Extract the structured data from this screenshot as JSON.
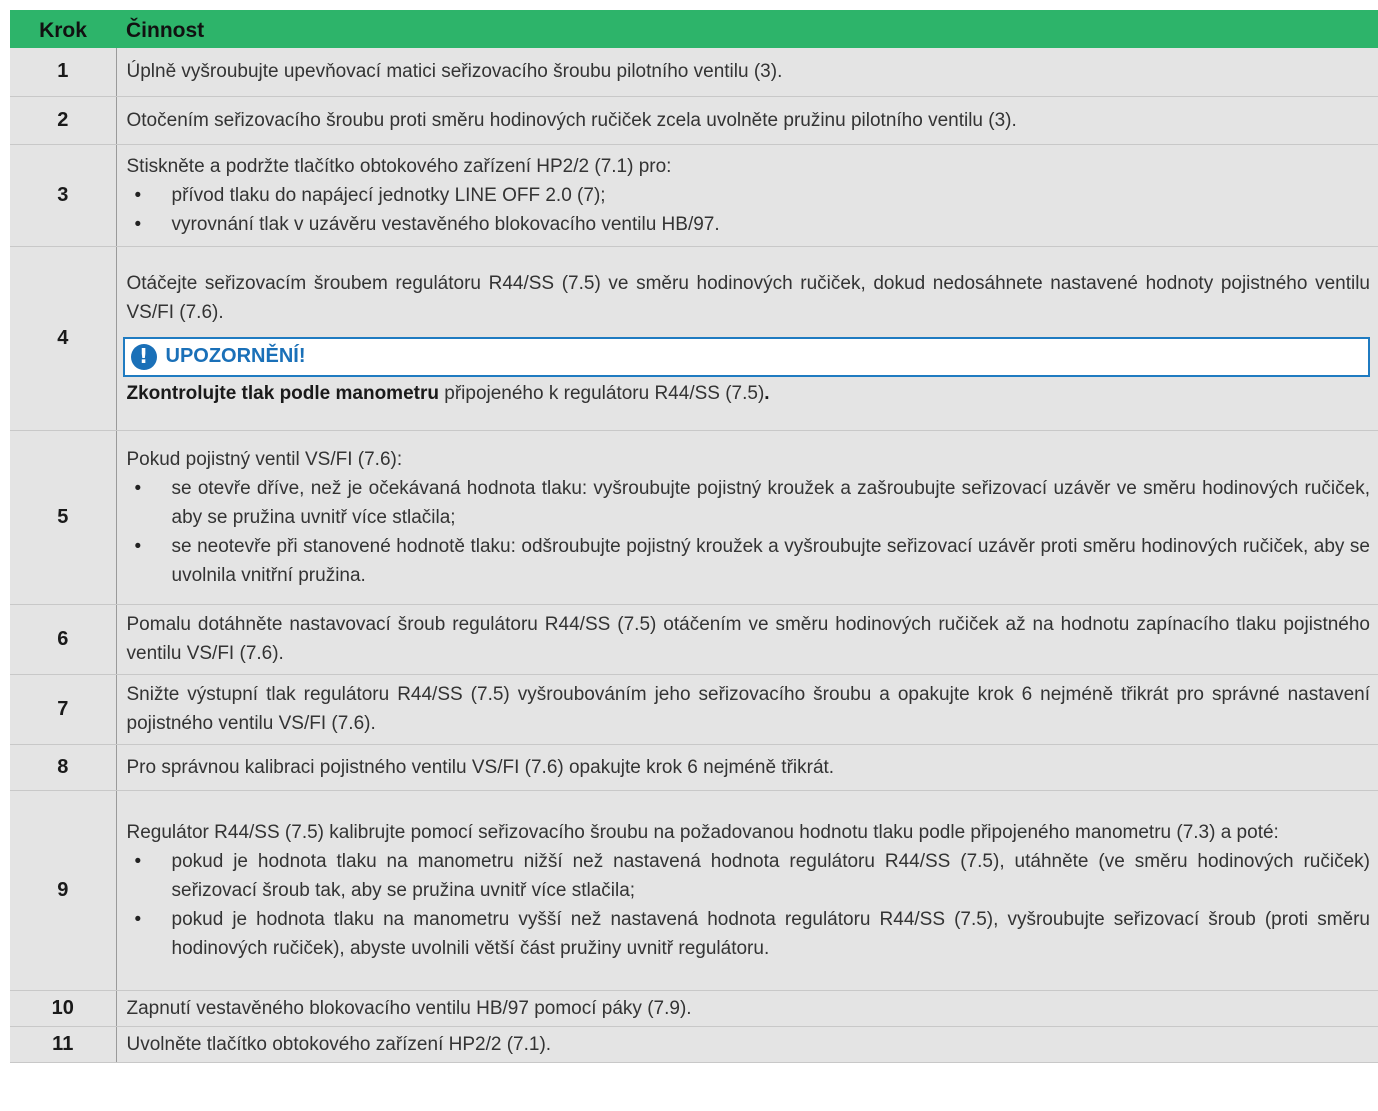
{
  "header": {
    "step": "Krok",
    "activity": "Činnost"
  },
  "rows": [
    {
      "step": "1",
      "text": "Úplně vyšroubujte upevňovací matici seřizovacího šroubu pilotního ventilu (3)."
    },
    {
      "step": "2",
      "text": "Otočením seřizovacího šroubu proti směru hodinových ručiček zcela uvolněte pružinu pilotního ventilu (3)."
    },
    {
      "step": "3",
      "text": "Stiskněte a podržte tlačítko obtokového zařízení HP2/2 (7.1) pro:",
      "bullets": [
        "přívod tlaku do napájecí jednotky LINE OFF 2.0 (7);",
        "vyrovnání tlak v uzávěru vestavěného blokovacího ventilu HB/97."
      ]
    },
    {
      "step": "4",
      "text": "Otáčejte seřizovacím šroubem regulátoru R44/SS (7.5) ve směru hodinových ručiček, dokud nedosáhnete nastavené hodnoty pojistného ventilu VS/FI (7.6).",
      "warning": {
        "icon": "exclamation-icon",
        "title": "UPOZORNĚNÍ!",
        "bold": "Zkontrolujte tlak podle manometru",
        "rest": " připojeného k regulátoru R44/SS (7.5)",
        "end": "."
      }
    },
    {
      "step": "5",
      "text": "Pokud pojistný ventil VS/FI (7.6):",
      "bullets": [
        "se otevře dříve, než je očekávaná hodnota tlaku: vyšroubujte pojistný kroužek a zašroubujte seřizovací uzávěr ve směru hodinových ručiček, aby se pružina uvnitř více stlačila;",
        "se neotevře při stanovené hodnotě tlaku: odšroubujte pojistný kroužek a vyšroubujte seřizovací uzávěr proti směru hodinových ručiček, aby se uvolnila vnitřní pružina."
      ]
    },
    {
      "step": "6",
      "text": "Pomalu dotáhněte nastavovací šroub regulátoru R44/SS (7.5) otáčením ve směru hodinových ručiček až na hodnotu zapínacího tlaku pojistného ventilu VS/FI (7.6)."
    },
    {
      "step": "7",
      "text": "Snižte výstupní tlak regulátoru R44/SS (7.5) vyšroubováním jeho seřizovacího šroubu a opakujte krok 6 nejméně třikrát pro správné nastavení pojistného ventilu VS/FI (7.6)."
    },
    {
      "step": "8",
      "text": "Pro správnou kalibraci pojistného ventilu VS/FI (7.6) opakujte krok 6 nejméně třikrát."
    },
    {
      "step": "9",
      "text": "Regulátor R44/SS (7.5) kalibrujte pomocí seřizovacího šroubu na požadovanou hodnotu tlaku podle připojeného manometru (7.3) a poté:",
      "bullets": [
        "pokud je hodnota tlaku na manometru nižší než nastavená hodnota regulátoru R44/SS (7.5), utáhněte (ve směru hodinových ručiček) seřizovací šroub tak, aby se pružina uvnitř více stlačila;",
        "pokud je hodnota tlaku na manometru vyšší než nastavená hodnota regulátoru R44/SS (7.5), vyšroubujte seřizovací šroub (proti směru hodinových ručiček), abyste uvolnili větší část pružiny uvnitř regulátoru."
      ]
    },
    {
      "step": "10",
      "text": "Zapnutí vestavěného blokovacího ventilu HB/97 pomocí páky (7.9)."
    },
    {
      "step": "11",
      "text": "Uvolněte tlačítko obtokového zařízení HP2/2 (7.1)."
    }
  ],
  "colors": {
    "header": "#2db46a",
    "row": "#e4e4e4",
    "warning": "#1a70b8"
  }
}
